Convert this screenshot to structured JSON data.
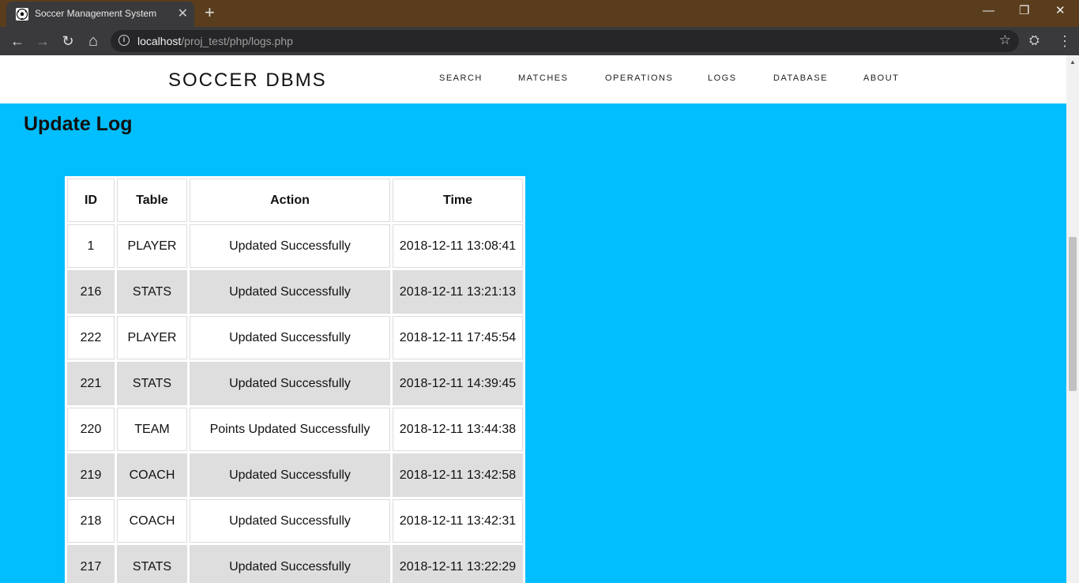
{
  "browser": {
    "tab_title": "Soccer Management System",
    "tab_close": "✕",
    "new_tab": "+",
    "url_host": "localhost",
    "url_path": "/proj_test/php/logs.php",
    "back": "←",
    "forward": "→",
    "reload": "↻",
    "home": "⌂",
    "info": "i",
    "star": "☆",
    "extension": "⛭",
    "menu": "⋮",
    "minimize": "—",
    "restore": "❐",
    "close": "✕"
  },
  "site": {
    "brand": "SOCCER DBMS",
    "nav": [
      "SEARCH",
      "MATCHES",
      "OPERATIONS",
      "LOGS",
      "DATABASE",
      "ABOUT"
    ]
  },
  "main": {
    "title": "Update Log",
    "table": {
      "headers": [
        "ID",
        "Table",
        "Action",
        "Time"
      ],
      "rows": [
        [
          "1",
          "PLAYER",
          "Updated Successfully",
          "2018-12-11 13:08:41"
        ],
        [
          "216",
          "STATS",
          "Updated Successfully",
          "2018-12-11 13:21:13"
        ],
        [
          "222",
          "PLAYER",
          "Updated Successfully",
          "2018-12-11 17:45:54"
        ],
        [
          "221",
          "STATS",
          "Updated Successfully",
          "2018-12-11 14:39:45"
        ],
        [
          "220",
          "TEAM",
          "Points Updated Successfully",
          "2018-12-11 13:44:38"
        ],
        [
          "219",
          "COACH",
          "Updated Successfully",
          "2018-12-11 13:42:58"
        ],
        [
          "218",
          "COACH",
          "Updated Successfully",
          "2018-12-11 13:42:31"
        ],
        [
          "217",
          "STATS",
          "Updated Successfully",
          "2018-12-11 13:22:29"
        ]
      ]
    }
  },
  "colors": {
    "page_background": "#01befe",
    "tabbar": "#5a3d1c",
    "alt_row": "#dedede"
  }
}
